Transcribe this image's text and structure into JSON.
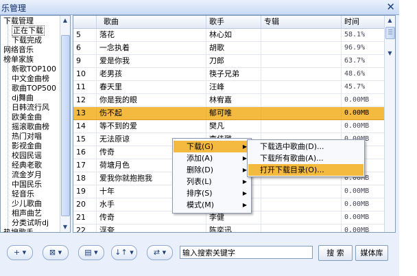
{
  "window": {
    "title": "乐管理",
    "close_label": "✕"
  },
  "sidebar": {
    "items": [
      {
        "label": "下载管理",
        "indent": 0
      },
      {
        "label": "正在下载",
        "indent": 1,
        "selected": true
      },
      {
        "label": "下载完成",
        "indent": 1
      },
      {
        "label": "网络音乐",
        "indent": 0
      },
      {
        "label": "榜单家族",
        "indent": 0
      },
      {
        "label": "新歌TOP100",
        "indent": 1
      },
      {
        "label": "中文金曲榜",
        "indent": 1
      },
      {
        "label": "歌曲TOP500",
        "indent": 1
      },
      {
        "label": "dj舞曲",
        "indent": 1
      },
      {
        "label": "日韩流行风",
        "indent": 1
      },
      {
        "label": "欧美金曲",
        "indent": 1
      },
      {
        "label": "摇滚歌曲榜",
        "indent": 1
      },
      {
        "label": "热门对唱",
        "indent": 1
      },
      {
        "label": "影视金曲",
        "indent": 1
      },
      {
        "label": "校园民谣",
        "indent": 1
      },
      {
        "label": "经典老歌",
        "indent": 1
      },
      {
        "label": "流金岁月",
        "indent": 1
      },
      {
        "label": "中国民乐",
        "indent": 1
      },
      {
        "label": "轻音乐",
        "indent": 1
      },
      {
        "label": "少儿歌曲",
        "indent": 1
      },
      {
        "label": "相声曲艺",
        "indent": 1
      },
      {
        "label": "分类试听dj",
        "indent": 1
      },
      {
        "label": "热搜歌手",
        "indent": 0
      }
    ]
  },
  "table": {
    "columns": [
      "",
      "歌曲",
      "歌手",
      "专辑",
      "时间"
    ],
    "rows": [
      {
        "num": "5",
        "song": "落花",
        "artist": "林心如",
        "album": "",
        "time": "58.1%"
      },
      {
        "num": "6",
        "song": "一念执着",
        "artist": "胡歌",
        "album": "",
        "time": "96.9%"
      },
      {
        "num": "9",
        "song": "爱是你我",
        "artist": "刀郎",
        "album": "",
        "time": "63.7%"
      },
      {
        "num": "10",
        "song": "老男孩",
        "artist": "筷子兄弟",
        "album": "",
        "time": "48.6%"
      },
      {
        "num": "11",
        "song": "春天里",
        "artist": "汪峰",
        "album": "",
        "time": "45.7%"
      },
      {
        "num": "12",
        "song": "你是我的眼",
        "artist": "林宥嘉",
        "album": "",
        "time": "0.00MB"
      },
      {
        "num": "13",
        "song": "伤不起",
        "artist": "郁可唯",
        "album": "",
        "time": "0.00MB",
        "selected": true
      },
      {
        "num": "14",
        "song": "等不到的爱",
        "artist": "樊凡",
        "album": "",
        "time": "0.00MB"
      },
      {
        "num": "15",
        "song": "无法原谅",
        "artist": "李佳璐",
        "album": "",
        "time": "0.00MB"
      },
      {
        "num": "16",
        "song": "传奇",
        "artist": "",
        "album": "",
        "time": ""
      },
      {
        "num": "17",
        "song": "荷塘月色",
        "artist": "",
        "album": "",
        "time": ""
      },
      {
        "num": "18",
        "song": "爱我你就抱抱我",
        "artist": "",
        "album": "",
        "time": "0.00MB"
      },
      {
        "num": "19",
        "song": "十年",
        "artist": "",
        "album": "",
        "time": "0.00MB"
      },
      {
        "num": "20",
        "song": "水手",
        "artist": "",
        "album": "",
        "time": "0.00MB"
      },
      {
        "num": "21",
        "song": "传奇",
        "artist": "李健",
        "album": "",
        "time": "0.00MB"
      },
      {
        "num": "22",
        "song": "浮夸",
        "artist": "陈奕迅",
        "album": "",
        "time": "0.00MB"
      }
    ]
  },
  "context_menu": {
    "items": [
      {
        "label": "下载(G)",
        "has_sub": true,
        "highlighted": true
      },
      {
        "label": "添加(A)",
        "has_sub": true
      },
      {
        "label": "删除(D)",
        "has_sub": true
      },
      {
        "label": "列表(L)",
        "has_sub": true
      },
      {
        "label": "排序(S)",
        "has_sub": true
      },
      {
        "label": "模式(M)",
        "has_sub": true
      }
    ],
    "submenu": [
      {
        "label": "下载选中歌曲(D)..."
      },
      {
        "label": "下载所有歌曲(A)..."
      },
      {
        "label": "打开下载目录(O)...",
        "highlighted": true
      }
    ],
    "arrow": "▶"
  },
  "toolbar": {
    "buttons": [
      {
        "label": "+ ▾",
        "icon": "add-icon"
      },
      {
        "label": "⊠ ▾",
        "icon": "delete-icon"
      },
      {
        "label": "▤ ▾",
        "icon": "list-icon"
      },
      {
        "label": "↓↑ ▾",
        "icon": "sort-icon"
      },
      {
        "label": "⇄ ▾",
        "icon": "mode-icon"
      }
    ],
    "search_value": "输入搜索关键字",
    "search_button": "搜 索",
    "media_button": "媒体库"
  }
}
